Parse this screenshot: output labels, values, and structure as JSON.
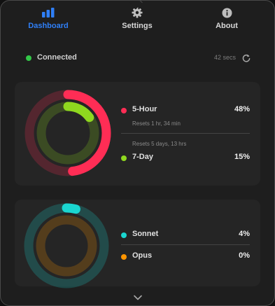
{
  "tabs": [
    {
      "label": "Dashboard",
      "icon": "bar-chart-icon",
      "active": true
    },
    {
      "label": "Settings",
      "icon": "gear-icon",
      "active": false
    },
    {
      "label": "About",
      "icon": "info-icon",
      "active": false
    }
  ],
  "status": {
    "label": "Connected",
    "updated": "42 secs",
    "icon": "refresh-icon",
    "color": "#33c748"
  },
  "usage_card": {
    "items": [
      {
        "name": "5-Hour",
        "percent_label": "48%",
        "percent": 0.48,
        "color": "#ff2d55",
        "subtitle": "Resets 1 hr, 34 min"
      },
      {
        "name": "7-Day",
        "percent_label": "15%",
        "percent": 0.15,
        "color": "#8fd81f",
        "subtitle": "Resets 5 days, 13 hrs"
      }
    ]
  },
  "model_card": {
    "items": [
      {
        "name": "Sonnet",
        "percent_label": "4%",
        "percent": 0.04,
        "color": "#1ad6d0"
      },
      {
        "name": "Opus",
        "percent_label": "0%",
        "percent": 0.0,
        "color": "#ff9500"
      }
    ]
  },
  "footer": {
    "icon": "chevron-down-icon"
  }
}
